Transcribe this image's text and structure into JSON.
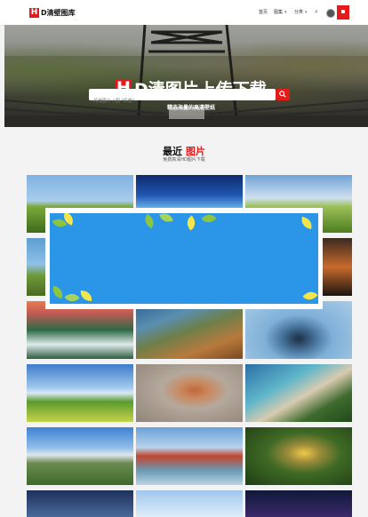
{
  "header": {
    "logo_letter": "H",
    "logo_text": "D清壁图库",
    "nav": [
      "首页",
      "图集",
      "分类"
    ],
    "icon_names": [
      "search-icon",
      "user-avatar-icon",
      "menu-icon"
    ]
  },
  "hero": {
    "title_letter": "H",
    "title_rest": "D清图片上传下载",
    "subtitle": "精选海量的高清壁纸",
    "search_placeholder": "风景图片 | 图 \"风景\"",
    "search_button_icon": "search-icon"
  },
  "section": {
    "title_main": "最近",
    "title_red": "图片",
    "subtitle": "免费高清HD图片下载"
  },
  "colors": {
    "accent": "#e51b1b",
    "overlay_blue": "#2b96e8",
    "leaf_green": "#8cc63f",
    "leaf_yellow": "#f2e64a"
  }
}
